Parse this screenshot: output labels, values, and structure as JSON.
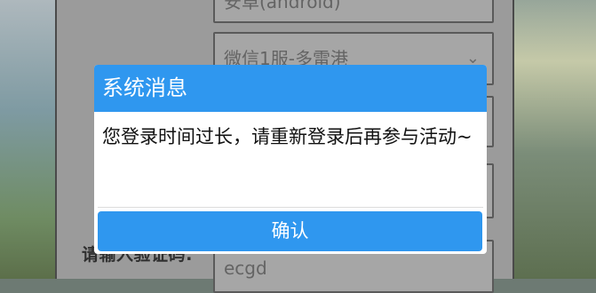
{
  "background": {
    "form": {
      "platform_value": "安卓(android)",
      "server_value": "微信1服-多雷港",
      "code_label": "请输入验证码:",
      "code_value": "ecgd"
    }
  },
  "dialog": {
    "title": "系统消息",
    "message": "您登录时间过长，请重新登录后再参与活动~",
    "confirm_label": "确认"
  },
  "colors": {
    "accent": "#2f97ef",
    "dialog_bg": "#ffffff",
    "panel_bg": "#9b9b9b"
  },
  "icons": {
    "server_dropdown": "chevron-down-icon"
  }
}
